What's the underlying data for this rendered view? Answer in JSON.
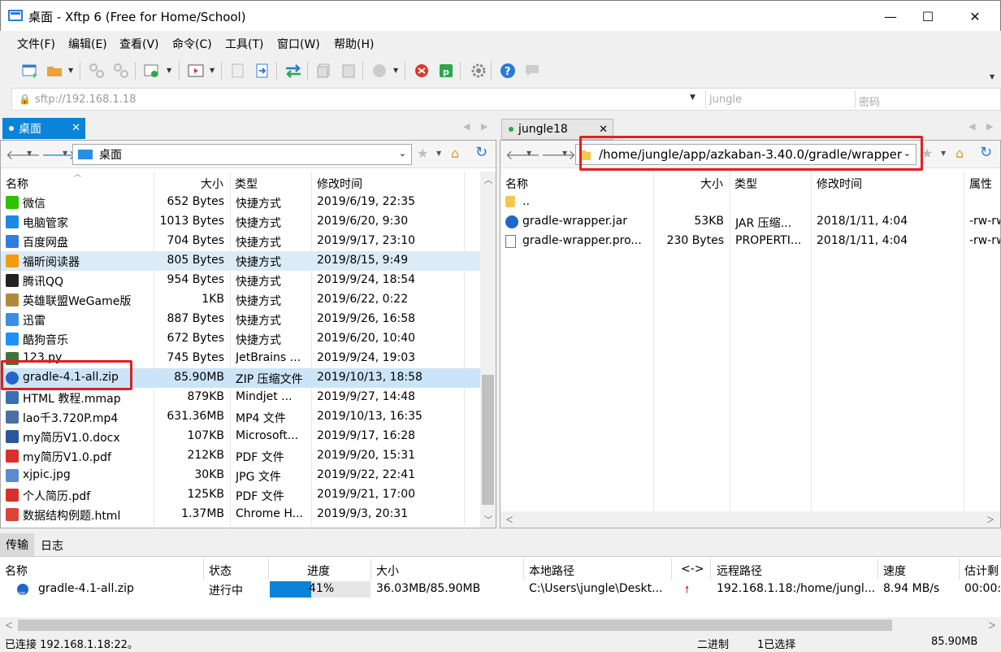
{
  "window": {
    "title": "桌面 - Xftp 6 (Free for Home/School)",
    "minimize": "—",
    "maximize": "☐",
    "close": "✕"
  },
  "menu": [
    "文件(F)",
    "编辑(E)",
    "查看(V)",
    "命令(C)",
    "工具(T)",
    "窗口(W)",
    "帮助(H)"
  ],
  "address": {
    "url": "sftp://192.168.1.18",
    "user_placeholder": "jungle",
    "password_placeholder": "密码"
  },
  "left": {
    "tab": "桌面",
    "path": "桌面",
    "columns": [
      "名称",
      "大小",
      "类型",
      "修改时间"
    ],
    "files": [
      {
        "name": "微信",
        "size": "652 Bytes",
        "type": "快捷方式",
        "mtime": "2019/6/19, 22:35",
        "icon": "wechat-icon",
        "color": "#2dc100"
      },
      {
        "name": "电脑管家",
        "size": "1013 Bytes",
        "type": "快捷方式",
        "mtime": "2019/6/20, 9:30",
        "icon": "pcmgr-icon",
        "color": "#1e88e5"
      },
      {
        "name": "百度网盘",
        "size": "704 Bytes",
        "type": "快捷方式",
        "mtime": "2019/9/17, 23:10",
        "icon": "baidu-icon",
        "color": "#2f7de1"
      },
      {
        "name": "福昕阅读器",
        "size": "805 Bytes",
        "type": "快捷方式",
        "mtime": "2019/8/15, 9:49",
        "icon": "foxit-icon",
        "color": "#f39c12"
      },
      {
        "name": "腾讯QQ",
        "size": "954 Bytes",
        "type": "快捷方式",
        "mtime": "2019/9/24, 18:54",
        "icon": "qq-icon",
        "color": "#222222"
      },
      {
        "name": "英雄联盟WeGame版",
        "size": "1KB",
        "type": "快捷方式",
        "mtime": "2019/6/22, 0:22",
        "icon": "lol-icon",
        "color": "#b08a3c"
      },
      {
        "name": "迅雷",
        "size": "887 Bytes",
        "type": "快捷方式",
        "mtime": "2019/9/26, 16:58",
        "icon": "xunlei-icon",
        "color": "#3a8ee6"
      },
      {
        "name": "酷狗音乐",
        "size": "672 Bytes",
        "type": "快捷方式",
        "mtime": "2019/6/20, 10:40",
        "icon": "kugou-icon",
        "color": "#1e90ff"
      },
      {
        "name": "123.py",
        "size": "745 Bytes",
        "type": "JetBrains ...",
        "mtime": "2019/9/24, 19:03",
        "icon": "python-icon",
        "color": "#3c763d"
      },
      {
        "name": "gradle-4.1-all.zip",
        "size": "85.90MB",
        "type": "ZIP 压缩文件",
        "mtime": "2019/10/13, 18:58",
        "icon": "zip-icon",
        "color": "#2266cc"
      },
      {
        "name": "HTML 教程.mmap",
        "size": "879KB",
        "type": "Mindjet ...",
        "mtime": "2019/9/27, 14:48",
        "icon": "mindjet-icon",
        "color": "#3a6fb0"
      },
      {
        "name": "lao千3.720P.mp4",
        "size": "631.36MB",
        "type": "MP4 文件",
        "mtime": "2019/10/13, 16:35",
        "icon": "video-icon",
        "color": "#4a6fa5"
      },
      {
        "name": "my简历V1.0.docx",
        "size": "107KB",
        "type": "Microsoft...",
        "mtime": "2019/9/17, 16:28",
        "icon": "word-icon",
        "color": "#2b579a"
      },
      {
        "name": "my简历V1.0.pdf",
        "size": "212KB",
        "type": "PDF 文件",
        "mtime": "2019/9/20, 15:31",
        "icon": "pdf-icon",
        "color": "#d9302c"
      },
      {
        "name": "xjpic.jpg",
        "size": "30KB",
        "type": "JPG 文件",
        "mtime": "2019/9/22, 22:41",
        "icon": "image-icon",
        "color": "#5b8bd0"
      },
      {
        "name": "个人简历.pdf",
        "size": "125KB",
        "type": "PDF 文件",
        "mtime": "2019/9/21, 17:00",
        "icon": "pdf-icon",
        "color": "#d9302c"
      },
      {
        "name": "数据结构例题.html",
        "size": "1.37MB",
        "type": "Chrome H...",
        "mtime": "2019/9/3, 20:31",
        "icon": "chrome-icon",
        "color": "#db4437"
      }
    ]
  },
  "right": {
    "tab": "jungle18",
    "path": "/home/jungle/app/azkaban-3.40.0/gradle/wrapper",
    "columns": [
      "名称",
      "大小",
      "类型",
      "修改时间",
      "属性"
    ],
    "files": [
      {
        "name": "..",
        "size": "",
        "type": "",
        "mtime": "",
        "attr": "",
        "icon": "folder-icon",
        "color": "#f2c94c"
      },
      {
        "name": "gradle-wrapper.jar",
        "size": "53KB",
        "type": "JAR 压缩...",
        "mtime": "2018/1/11, 4:04",
        "attr": "-rw-rw",
        "icon": "jar-icon",
        "color": "#2266cc"
      },
      {
        "name": "gradle-wrapper.pro...",
        "size": "230 Bytes",
        "type": "PROPERTI...",
        "mtime": "2018/1/11, 4:04",
        "attr": "-rw-rw",
        "icon": "file-icon",
        "color": "#ffffff"
      }
    ]
  },
  "transfer": {
    "tabs": [
      "传输",
      "日志"
    ],
    "columns": [
      "名称",
      "状态",
      "进度",
      "大小",
      "本地路径",
      "<->",
      "远程路径",
      "速度",
      "估计剩"
    ],
    "rows": [
      {
        "name": "gradle-4.1-all.zip",
        "status": "进行中",
        "progress": 0.41,
        "progress_label": "41%",
        "size": "36.03MB/85.90MB",
        "local": "C:\\Users\\jungle\\Deskt...",
        "remote": "192.168.1.18:/home/jungl...",
        "speed": "8.94 MB/s",
        "eta": "00:00:"
      }
    ]
  },
  "status": {
    "left": "已连接 192.168.1.18:22。",
    "mode": "二进制",
    "selection": "1已选择",
    "size": "85.90MB"
  },
  "colors": {
    "accent": "#0a84d8",
    "progress": "#0a84d8",
    "highlight_red": "#e02020"
  }
}
